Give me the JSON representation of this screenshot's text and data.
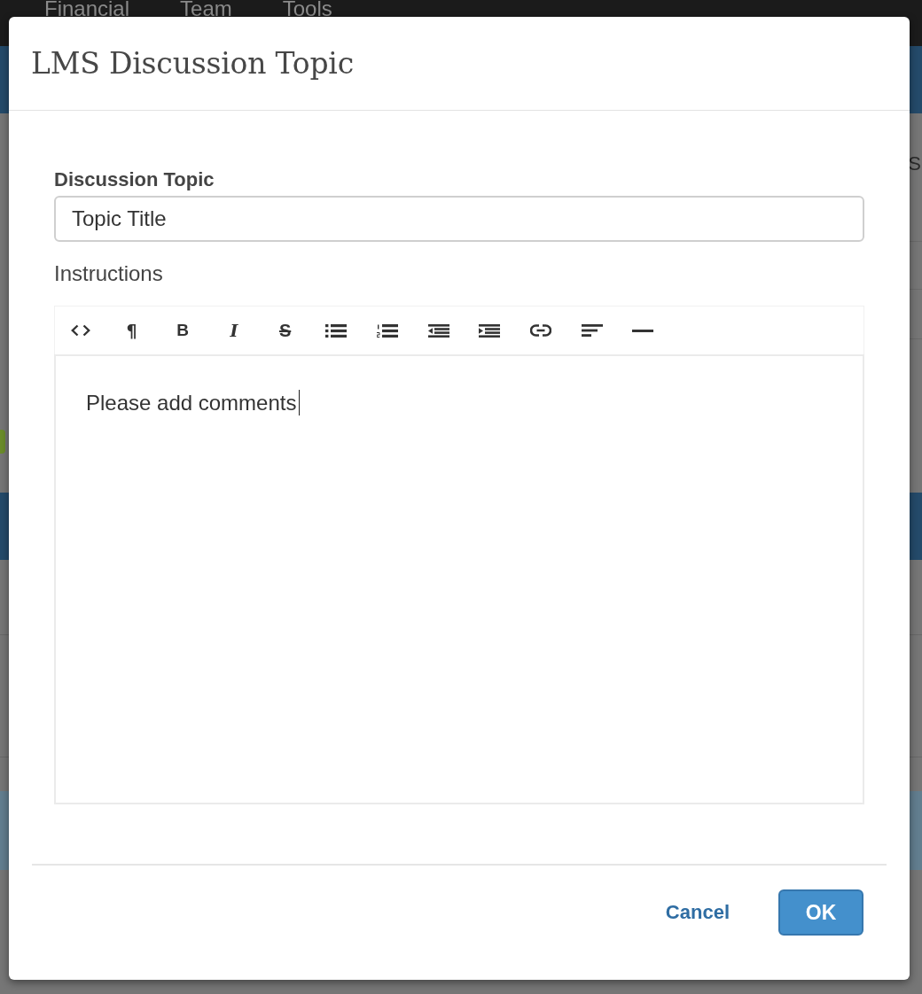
{
  "backdrop": {
    "nav_items": [
      "Financial",
      "Team",
      "Tools"
    ],
    "right_edge_text": "S"
  },
  "dialog": {
    "title": "LMS Discussion Topic",
    "topic_field": {
      "label": "Discussion Topic",
      "value": "Topic Title"
    },
    "instructions": {
      "label": "Instructions",
      "toolbar": [
        {
          "kind": "code"
        },
        {
          "kind": "paragraph",
          "label": "¶"
        },
        {
          "kind": "bold",
          "label": "B"
        },
        {
          "kind": "italic",
          "label": "I"
        },
        {
          "kind": "strikethrough",
          "label": "S"
        },
        {
          "kind": "bullet_list"
        },
        {
          "kind": "numbered_list"
        },
        {
          "kind": "outdent"
        },
        {
          "kind": "indent"
        },
        {
          "kind": "link"
        },
        {
          "kind": "align"
        },
        {
          "kind": "horizontal_rule"
        }
      ],
      "content": "Please add comments",
      "focused": true
    },
    "buttons": [
      {
        "label": "Cancel",
        "kind": "cancel"
      },
      {
        "label": "OK",
        "kind": "confirm"
      }
    ]
  }
}
